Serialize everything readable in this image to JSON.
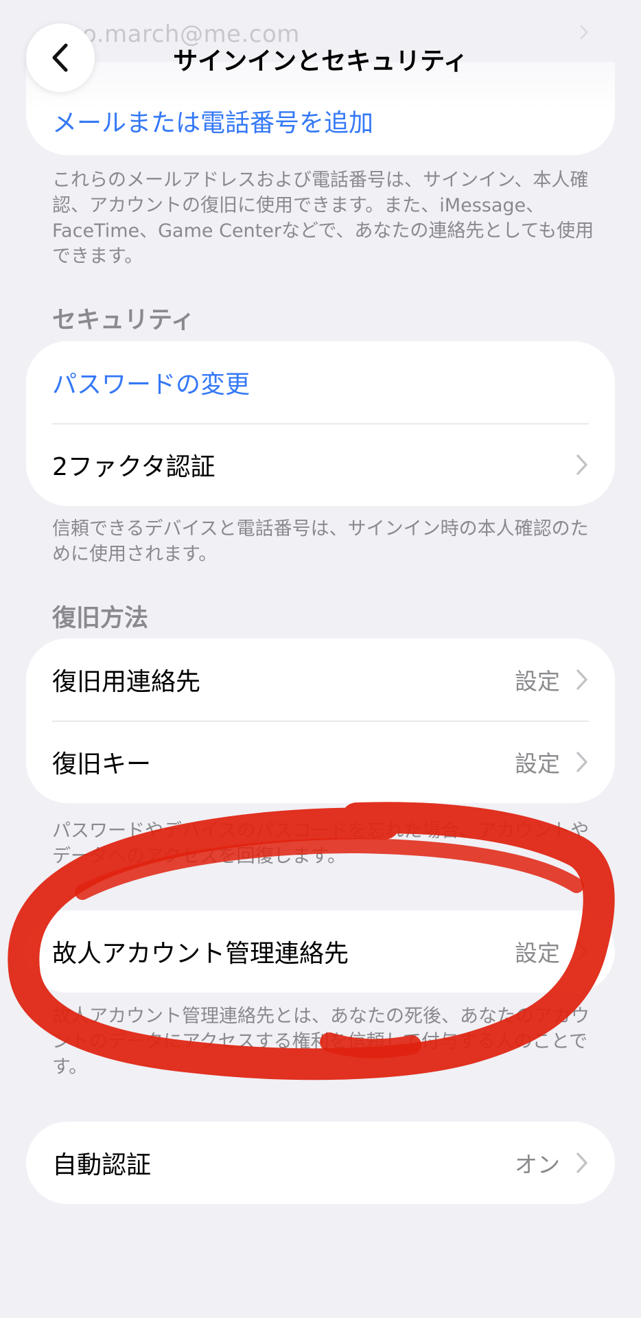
{
  "nav": {
    "title": "サインインとセキュリティ",
    "email_behind": "o.march@me.com"
  },
  "emails": {
    "add_label": "メールまたは電話番号を追加",
    "footer": "これらのメールアドレスおよび電話番号は、サインイン、本人確認、アカウントの復旧に使用できます。また、iMessage、FaceTime、Game Centerなどで、あなたの連絡先としても使用できます。"
  },
  "security": {
    "header": "セキュリティ",
    "password_label": "パスワードの変更",
    "two_factor_label": "2ファクタ認証",
    "footer": "信頼できるデバイスと電話番号は、サインイン時の本人確認のために使用されます。"
  },
  "recovery": {
    "header": "復旧方法",
    "contacts_label": "復旧用連絡先",
    "contacts_value": "設定",
    "key_label": "復旧キー",
    "key_value": "設定",
    "footer": "パスワードやデバイスのパスコードを忘れた場合、アカウントやデータへのアクセスを回復します。"
  },
  "legacy": {
    "label": "故人アカウント管理連絡先",
    "value": "設定",
    "footer": "故人アカウント管理連絡先とは、あなたの死後、あなたのアカウントのデータにアクセスする権利を信頼して付与する人のことです。"
  },
  "auto_verify": {
    "label": "自動認証",
    "value": "オン"
  },
  "colors": {
    "background": "#f0f0f5",
    "link": "#3478f6",
    "secondary_text": "#8a8a8e",
    "annotation": "#e0220f"
  },
  "icons": [
    "back-chevron-icon",
    "chevron-right-icon"
  ]
}
